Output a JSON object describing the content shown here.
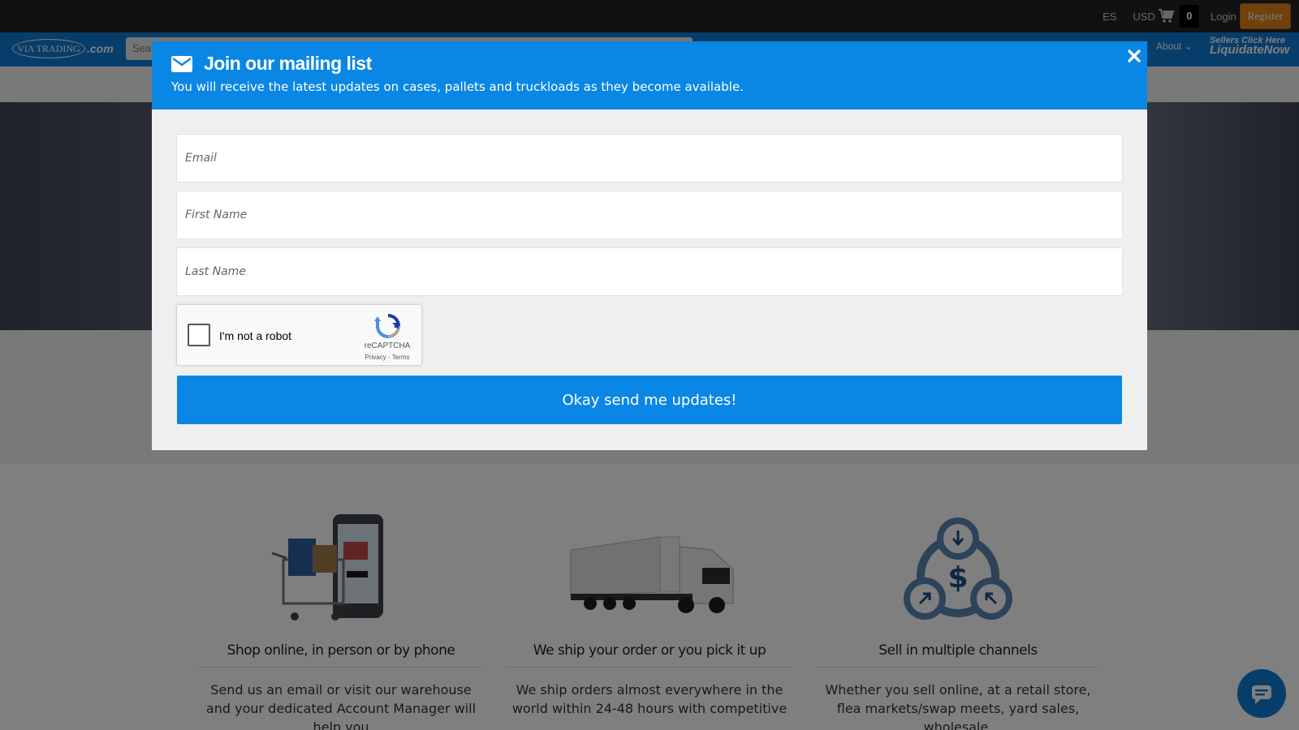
{
  "topbar": {
    "lang": "ES",
    "currency": "USD",
    "cart_count": "0",
    "login": "Login",
    "register": "Register"
  },
  "navbar": {
    "logo_text": "VIA TRADING",
    "logo_suffix": ".com",
    "search_placeholder": "Sea",
    "about": "About",
    "sellers_line1": "Sellers Click Here",
    "sellers_line2": "LiquidateNow"
  },
  "modal": {
    "title": "Join our mailing list",
    "subtitle": "You will receive the latest updates on cases, pallets and truckloads as they become available.",
    "fields": {
      "email_placeholder": "Email",
      "first_name_placeholder": "First Name",
      "last_name_placeholder": "Last Name"
    },
    "captcha": {
      "label": "I'm not a robot",
      "brand": "reCAPTCHA",
      "links": "Privacy - Terms"
    },
    "submit": "Okay send me updates!"
  },
  "features": [
    {
      "icon": "phone-cart-icon",
      "title": "Shop online, in person or by phone",
      "text": "Send us an email or visit our warehouse and your dedicated Account Manager will help you"
    },
    {
      "icon": "truck-icon",
      "title": "We ship your order or you pick it up",
      "text": "We ship orders almost everywhere in the world within 24-48 hours with competitive"
    },
    {
      "icon": "dollar-cycle-icon",
      "title": "Sell in multiple channels",
      "text": "Whether you sell online, at a retail store, flea markets/swap meets, yard sales, wholesale,"
    }
  ],
  "colors": {
    "brand_blue": "#0a87e4",
    "nav_blue": "#0e7ad6",
    "register_orange": "#e0821b",
    "topbar_bg": "#222222"
  }
}
